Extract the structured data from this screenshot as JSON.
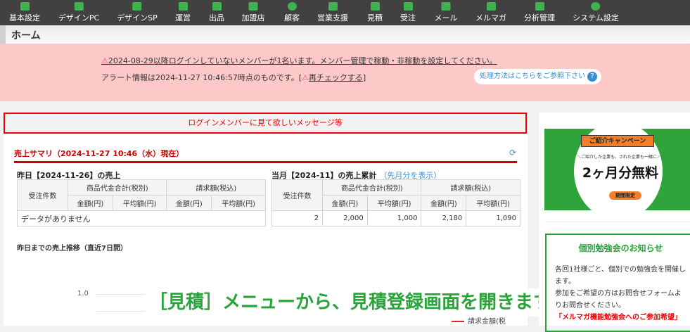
{
  "nav": [
    {
      "label": "基本設定",
      "icon": "sliders-icon"
    },
    {
      "label": "デザインPC",
      "icon": "monitor-icon"
    },
    {
      "label": "デザインSP",
      "icon": "smartphone-icon"
    },
    {
      "label": "運営",
      "icon": "archive-icon"
    },
    {
      "label": "出品",
      "icon": "tag-icon"
    },
    {
      "label": "加盟店",
      "icon": "store-add-icon"
    },
    {
      "label": "顧客",
      "icon": "user-icon"
    },
    {
      "label": "営業支援",
      "icon": "briefcase-icon"
    },
    {
      "label": "見積",
      "icon": "document-icon"
    },
    {
      "label": "受注",
      "icon": "cart-icon"
    },
    {
      "label": "メール",
      "icon": "mail-icon"
    },
    {
      "label": "メルマガ",
      "icon": "mail-settings-icon"
    },
    {
      "label": "分析管理",
      "icon": "bar-chart-icon"
    },
    {
      "label": "システム設定",
      "icon": "gear-icon"
    }
  ],
  "page_title": "ホーム",
  "alert": {
    "line1": "2024-08-29以降ログインしていないメンバーが1名います。メンバー管理で稼動・非稼動を設定してください。",
    "line2_prefix": "アラート情報は2024-11-27 10:46:57時点のものです。[",
    "recheck": "再チェックする",
    "line2_suffix": "]",
    "help": "処理方法はこちらをご参照下さい",
    "help_icon": "?"
  },
  "message": "ログインメンバーに見て欲しいメッセージ等",
  "summary": {
    "title": "売上サマリ（2024-11-27 10:46（水）現在）",
    "refresh_icon": "⟳",
    "yesterday": {
      "title": "昨日【2024-11-26】の売上",
      "h_count": "受注件数",
      "h_goods": "商品代金合計(税別)",
      "h_bill": "請求額(税込)",
      "h_amount": "金額(円)",
      "h_avg": "平均額(円)",
      "empty": "データがありません"
    },
    "month": {
      "title": "当月【2024-11】の売上累計",
      "link": "（先月分を表示）",
      "h_count": "受注件数",
      "h_goods": "商品代金合計(税別)",
      "h_bill": "請求額(税込)",
      "h_amount": "金額(円)",
      "h_avg": "平均額(円)",
      "count": "2",
      "goods_amount": "2,000",
      "goods_avg": "1,000",
      "bill_amount": "2,180",
      "bill_avg": "1,090"
    }
  },
  "chart": {
    "title": "昨日までの売上推移（直近7日間）",
    "ytick": "1.0",
    "legend": "請求金額(税"
  },
  "caption": "［見積］メニューから、見積登録画面を開きます",
  "sidebar": {
    "banner": {
      "ribbon": "ご紹介キャンペーン",
      "sub": "＼ご紹介した企業も、された企業も一緒に／",
      "big": "2ヶ月分無料",
      "limited": "期間限定"
    },
    "study": {
      "title": "個別勉強会のお知らせ",
      "p1": "各回1社様ごと、個別での勉強会を開催します。",
      "p2": "参加をご希望の方はお問合せフォームよりお問合せください。",
      "p3": "「メルマガ機能勉強会へのご参加希望」"
    }
  }
}
